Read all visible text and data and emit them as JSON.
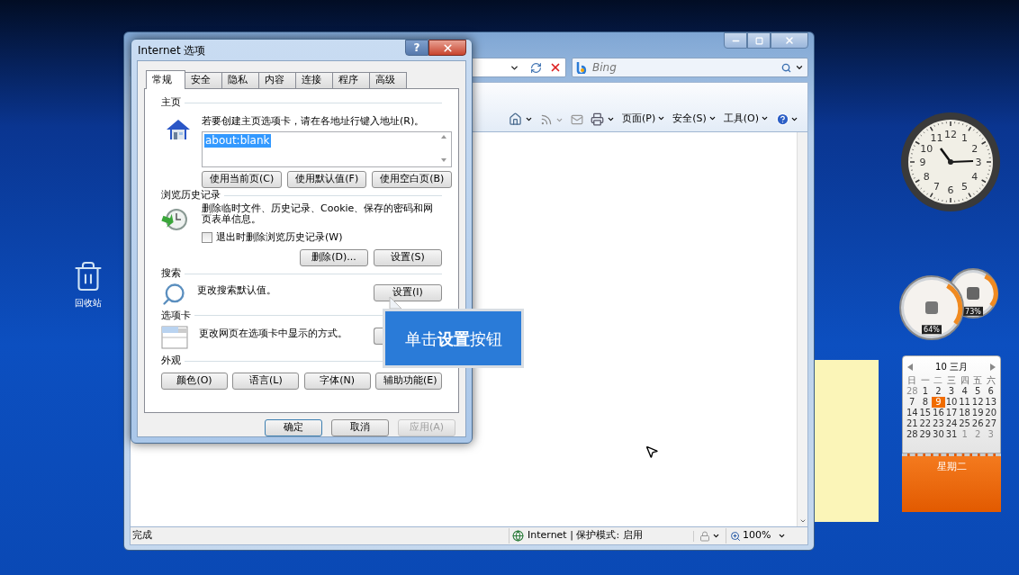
{
  "desktop": {
    "icons": [
      {
        "label": "回收站"
      }
    ]
  },
  "browser": {
    "search_placeholder": "Bing",
    "commands": [
      {
        "label": "页面(P)"
      },
      {
        "label": "安全(S)"
      },
      {
        "label": "工具(O)"
      }
    ],
    "status_bar": {
      "status": "完成",
      "zone": "Internet | 保护模式: 启用",
      "zoom": "100%"
    }
  },
  "dialog": {
    "title": "Internet 选项",
    "help": "?",
    "tabs": [
      {
        "label": "常规",
        "selected": true
      },
      {
        "label": "安全",
        "selected": false
      },
      {
        "label": "隐私",
        "selected": false
      },
      {
        "label": "内容",
        "selected": false
      },
      {
        "label": "连接",
        "selected": false
      },
      {
        "label": "程序",
        "selected": false
      },
      {
        "label": "高级",
        "selected": false
      }
    ],
    "sections": [
      {
        "kind": "homepage",
        "heading": "主页",
        "text": "若要创建主页选项卡，请在各地址行键入地址(R)。",
        "value": "about:blank",
        "buttons": [
          "使用当前页(C)",
          "使用默认值(F)",
          "使用空白页(B)"
        ]
      },
      {
        "kind": "history",
        "heading": "浏览历史记录",
        "text": "删除临时文件、历史记录、Cookie、保存的密码和网页表单信息。",
        "checkbox": {
          "label": "退出时删除浏览历史记录(W)",
          "checked": false
        },
        "buttons": [
          "删除(D)...",
          "设置(S)"
        ]
      },
      {
        "kind": "search",
        "heading": "搜索",
        "text": "更改搜索默认值。",
        "buttons": [
          "设置(I)"
        ]
      },
      {
        "kind": "tabs",
        "heading": "选项卡",
        "text": "更改网页在选项卡中显示的方式。"
      },
      {
        "kind": "appearance",
        "heading": "外观",
        "buttons": [
          "颜色(O)",
          "语言(L)",
          "字体(N)",
          "辅助功能(E)"
        ]
      }
    ],
    "footer_buttons": [
      {
        "label": "确定",
        "default": true,
        "disabled": false
      },
      {
        "label": "取消",
        "default": false,
        "disabled": false
      },
      {
        "label": "应用(A)",
        "default": false,
        "disabled": true
      }
    ]
  },
  "callout": {
    "text": "单击**设置**按钮"
  },
  "gadgets": {
    "clock": {
      "numerals": [
        "11",
        "12",
        "1",
        "10",
        "2",
        "9",
        "3",
        "8",
        "4",
        "7",
        "6",
        "5"
      ]
    },
    "meters": [
      {
        "reading": "64%"
      },
      {
        "reading": "73%"
      }
    ],
    "calendar": {
      "title": "10 三月",
      "weekdays": [
        "日",
        "一",
        "二",
        "三",
        "四",
        "五",
        "六"
      ],
      "footer": "星期二",
      "weeks": [
        [
          {
            "day": "28",
            "outside": true,
            "selected": false
          },
          {
            "day": "1",
            "outside": false,
            "selected": false
          },
          {
            "day": "2",
            "outside": false,
            "selected": false
          },
          {
            "day": "3",
            "outside": false,
            "selected": false
          },
          {
            "day": "4",
            "outside": false,
            "selected": false
          },
          {
            "day": "5",
            "outside": false,
            "selected": false
          },
          {
            "day": "6",
            "outside": false,
            "selected": false
          }
        ],
        [
          {
            "day": "7",
            "outside": false,
            "selected": false
          },
          {
            "day": "8",
            "outside": false,
            "selected": false
          },
          {
            "day": "9",
            "outside": false,
            "selected": true
          },
          {
            "day": "10",
            "outside": false,
            "selected": false
          },
          {
            "day": "11",
            "outside": false,
            "selected": false
          },
          {
            "day": "12",
            "outside": false,
            "selected": false
          },
          {
            "day": "13",
            "outside": false,
            "selected": false
          }
        ],
        [
          {
            "day": "14",
            "outside": false,
            "selected": false
          },
          {
            "day": "15",
            "outside": false,
            "selected": false
          },
          {
            "day": "16",
            "outside": false,
            "selected": false
          },
          {
            "day": "17",
            "outside": false,
            "selected": false
          },
          {
            "day": "18",
            "outside": false,
            "selected": false
          },
          {
            "day": "19",
            "outside": false,
            "selected": false
          },
          {
            "day": "20",
            "outside": false,
            "selected": false
          }
        ],
        [
          {
            "day": "21",
            "outside": false,
            "selected": false
          },
          {
            "day": "22",
            "outside": false,
            "selected": false
          },
          {
            "day": "23",
            "outside": false,
            "selected": false
          },
          {
            "day": "24",
            "outside": false,
            "selected": false
          },
          {
            "day": "25",
            "outside": false,
            "selected": false
          },
          {
            "day": "26",
            "outside": false,
            "selected": false
          },
          {
            "day": "27",
            "outside": false,
            "selected": false
          }
        ],
        [
          {
            "day": "28",
            "outside": false,
            "selected": false
          },
          {
            "day": "29",
            "outside": false,
            "selected": false
          },
          {
            "day": "30",
            "outside": false,
            "selected": false
          },
          {
            "day": "31",
            "outside": false,
            "selected": false
          },
          {
            "day": "1",
            "outside": true,
            "selected": false
          },
          {
            "day": "2",
            "outside": true,
            "selected": false
          },
          {
            "day": "3",
            "outside": true,
            "selected": false
          }
        ]
      ]
    }
  }
}
